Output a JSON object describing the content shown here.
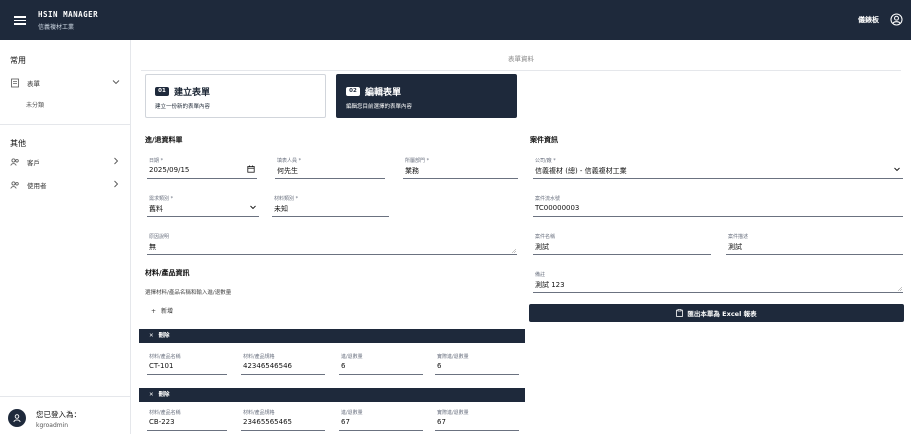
{
  "app": {
    "title": "HSIN MANAGER",
    "subtitle": "信義複材工業"
  },
  "header": {
    "right_label": "儀錶板"
  },
  "sidebar": {
    "group_common": "常用",
    "item_forms": "表單",
    "sub_uncategorized": "未分類",
    "group_other": "其他",
    "item_customers": "客戶",
    "item_users": "使用者",
    "login_label": "您已登入為：",
    "login_user": "kgroadmin"
  },
  "main": {
    "breadcrumb": "表單資料",
    "steps": [
      {
        "num": "01",
        "title": "建立表單",
        "desc": "建立一份新的表單內容"
      },
      {
        "num": "02",
        "title": "編輯表單",
        "desc": "編輯您目前選擇的表單內容"
      }
    ],
    "left_section_title": "進/退資料單",
    "fields": {
      "date": {
        "label": "日期 *",
        "value": "2025/09/15"
      },
      "filler": {
        "label": "填表人員 *",
        "value": "何先生"
      },
      "dept": {
        "label": "所屬部門 *",
        "value": "業務"
      },
      "category": {
        "label": "需求類別 *",
        "value": "舊料"
      },
      "material_type": {
        "label": "材料類別 *",
        "value": "未知"
      },
      "note": {
        "label": "原因說明",
        "value": "無"
      }
    },
    "materials_title": "材料/產品資訊",
    "materials_hint": "選擇材料/產品名稱和輸入進/退數量",
    "add_label": "新增",
    "delete_label": "刪除",
    "material_rows": [
      {
        "name_label": "材料/產品名稱",
        "name": "CT-101",
        "spec_label": "材料/產品規格",
        "spec": "42346546546",
        "qty_label": "進/退數量",
        "qty": "6",
        "actual_label": "實際進/退數量",
        "actual": "6"
      },
      {
        "name_label": "材料/產品名稱",
        "name": "CB-223",
        "spec_label": "材料/產品規格",
        "spec": "23465565465",
        "qty_label": "進/退數量",
        "qty": "67",
        "actual_label": "實際進/退數量",
        "actual": "67"
      }
    ],
    "right_section_title": "案件資訊",
    "company": {
      "label": "公司/廠 *",
      "value": "信義複材 (總) - 信義複材工業"
    },
    "case_no": {
      "label": "案件流水號",
      "value": "TC00000003"
    },
    "case_name": {
      "label": "案件名稱",
      "value": "測試"
    },
    "case_desc": {
      "label": "案件描述",
      "value": "測試"
    },
    "remark": {
      "label": "備註",
      "value": "測試 123"
    },
    "export_label": "匯出本單為 Excel 報表"
  }
}
